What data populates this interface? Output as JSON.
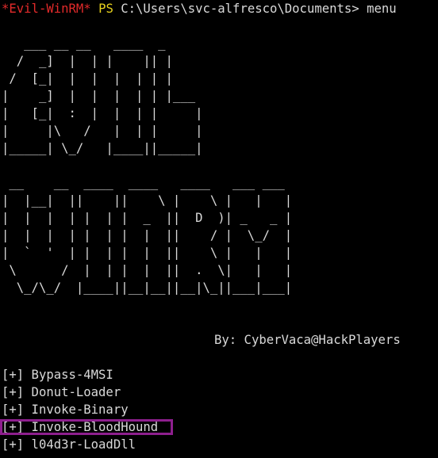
{
  "prompt": {
    "evil_tag": "*Evil-WinRM*",
    "ps_tag": "PS",
    "path": "C:\\Users\\svc-alfresco\\Documents>",
    "command": "menu"
  },
  "banner": {
    "evil_art": "   ___ __ __   ____  _     \n  /  _]  |  | |    || |    \n /  [_|  |  |  |  | | |    \n|    _]  |  |  |  | | |___ \n|   [_|  :  |  |  | |     |\n|     |\\   /   |  | |     |\n|_____| \\_/   |____||_____|",
    "winrm_art": " __    __  ____  ____   ____   ___ ___ \n|  |__|  ||    ||    \\ |    \\ |   |   |\n|  |  |  | |  | |  _  ||  D  )| _   _ |\n|  |  |  | |  | |  |  ||    / |  \\_/  |\n|  `  '  | |  | |  |  ||    \\ |   |   |\n \\      /  |  | |  |  ||  .  \\|   |   |\n  \\_/\\_/  |____||__|__||__|\\_||___|___|"
  },
  "author": "By: CyberVaca@HackPlayers",
  "menu": {
    "items": [
      {
        "label": "[+] Bypass-4MSI"
      },
      {
        "label": "[+] Donut-Loader"
      },
      {
        "label": "[+] Invoke-Binary"
      },
      {
        "label": "[+] Invoke-BloodHound"
      },
      {
        "label": "[+] l04d3r-LoadDll"
      }
    ]
  },
  "colors": {
    "background": "#000000",
    "text": "#d9d9d9",
    "evil_tag": "#e22a2a",
    "ps_tag": "#e8d21d",
    "highlight_box": "#8e1f8e"
  }
}
